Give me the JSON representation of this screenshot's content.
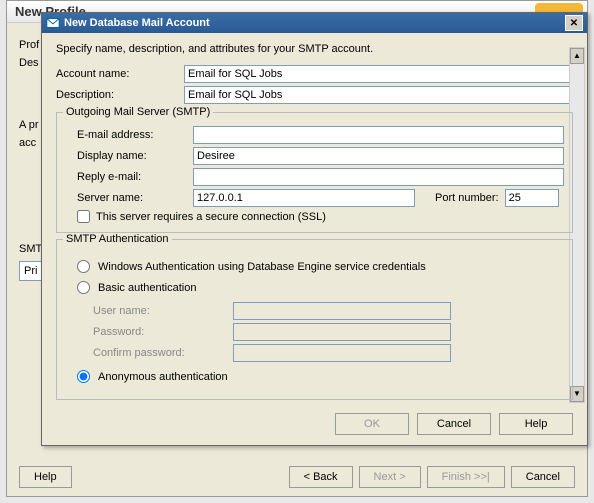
{
  "back": {
    "title": "New Profile",
    "prof": "Prof",
    "des": "Des",
    "apr": "A pr",
    "acc": "acc",
    "smt": "SMT",
    "pri": "Pri",
    "help": "Help",
    "back_btn": "< Back",
    "next_btn": "Next >",
    "finish_btn": "Finish >>|",
    "cancel_btn": "Cancel"
  },
  "dialog": {
    "title": "New Database Mail Account",
    "intro": "Specify name, description, and attributes for your SMTP account.",
    "account_name_lbl": "Account name:",
    "account_name": "Email for SQL Jobs",
    "description_lbl": "Description:",
    "description": "Email for SQL Jobs",
    "smtp_group": "Outgoing Mail Server (SMTP)",
    "email_lbl": "E-mail address:",
    "email": "",
    "display_lbl": "Display name:",
    "display": "Desiree",
    "reply_lbl": "Reply e-mail:",
    "reply": "",
    "server_lbl": "Server name:",
    "server": "127.0.0.1",
    "port_lbl": "Port number:",
    "port": "25",
    "ssl_lbl": "This server requires a secure connection (SSL)",
    "auth_group": "SMTP Authentication",
    "auth_win": "Windows Authentication using Database Engine service credentials",
    "auth_basic": "Basic authentication",
    "user_lbl": "User name:",
    "pass_lbl": "Password:",
    "confirm_lbl": "Confirm password:",
    "auth_anon": "Anonymous authentication",
    "ok": "OK",
    "cancel": "Cancel",
    "help": "Help"
  }
}
